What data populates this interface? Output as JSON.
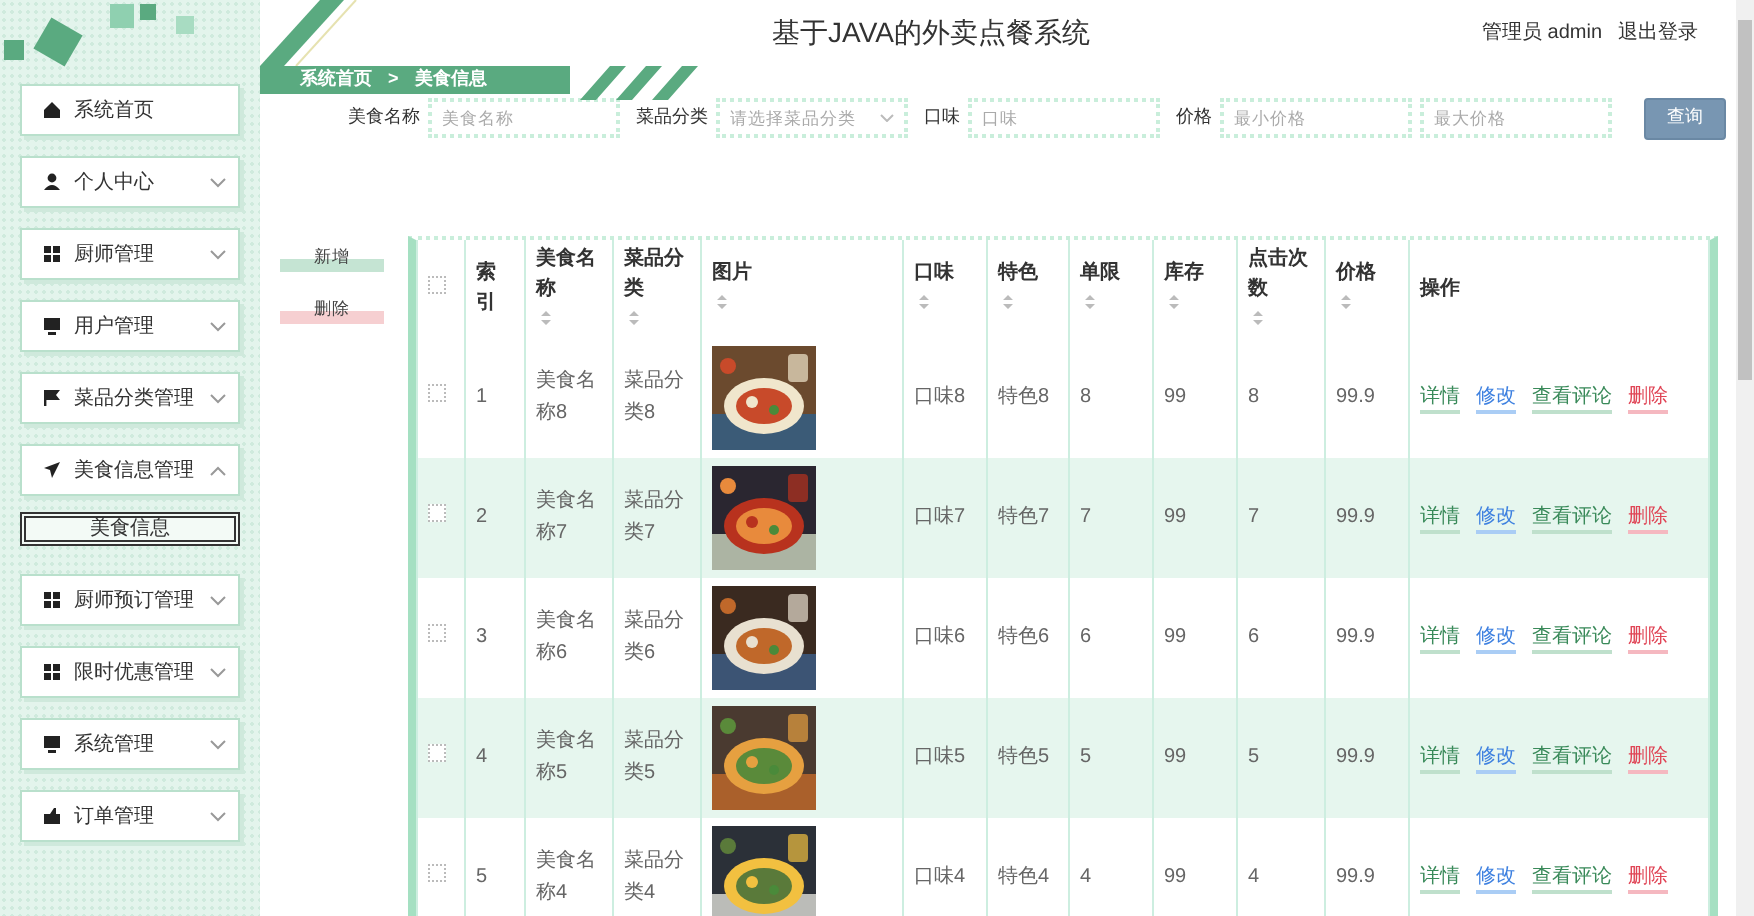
{
  "header": {
    "title": "基于JAVA的外卖点餐系统",
    "user": "管理员 admin",
    "logout": "退出登录"
  },
  "sidebar": {
    "items": [
      {
        "label": "系统首页"
      },
      {
        "label": "个人中心",
        "expanded": false
      },
      {
        "label": "厨师管理",
        "expanded": false
      },
      {
        "label": "用户管理",
        "expanded": false
      },
      {
        "label": "菜品分类管理",
        "expanded": false
      },
      {
        "label": "美食信息管理",
        "expanded": true,
        "children": [
          {
            "label": "美食信息",
            "selected": true
          }
        ]
      },
      {
        "label": "厨师预订管理",
        "expanded": false
      },
      {
        "label": "限时优惠管理",
        "expanded": false
      },
      {
        "label": "系统管理",
        "expanded": false
      },
      {
        "label": "订单管理",
        "expanded": false
      }
    ]
  },
  "breadcrumb": {
    "items": [
      "系统首页",
      "美食信息"
    ],
    "separator": ">"
  },
  "search": {
    "fields": [
      {
        "label": "美食名称",
        "placeholder": "美食名称",
        "kind": "input"
      },
      {
        "label": "菜品分类",
        "placeholder": "请选择菜品分类",
        "kind": "select"
      },
      {
        "label": "口味",
        "placeholder": "口味",
        "kind": "input"
      },
      {
        "label": "价格",
        "placeholder": "最小价格",
        "kind": "input"
      },
      {
        "placeholder": "最大价格",
        "kind": "input"
      }
    ],
    "button": "查询"
  },
  "actions": [
    {
      "label": "新增",
      "kind": "add"
    },
    {
      "label": "删除",
      "kind": "delete"
    }
  ],
  "table": {
    "select_all_checked": false,
    "columns": [
      {
        "label": "索引",
        "sortable": false
      },
      {
        "label": "美食名称",
        "sortable": true
      },
      {
        "label": "菜品分类",
        "sortable": true
      },
      {
        "label": "图片",
        "sortable": true
      },
      {
        "label": "口味",
        "sortable": true
      },
      {
        "label": "特色",
        "sortable": true
      },
      {
        "label": "单限",
        "sortable": true
      },
      {
        "label": "库存",
        "sortable": true
      },
      {
        "label": "点击次数",
        "sortable": true
      },
      {
        "label": "价格",
        "sortable": true
      },
      {
        "label": "操作",
        "sortable": false
      }
    ],
    "rows": [
      {
        "checked": false,
        "cells": [
          "1",
          "美食名称8",
          "菜品分类8",
          {
            "kind": "picture"
          },
          "口味8",
          "特色8",
          "8",
          "99",
          "8",
          "99.9"
        ],
        "actions": [
          {
            "label": "详情",
            "kind": "detail"
          },
          {
            "label": "修改",
            "kind": "edit"
          },
          {
            "label": "查看评论",
            "kind": "comments"
          },
          {
            "label": "删除",
            "kind": "delete"
          }
        ]
      },
      {
        "checked": false,
        "cells": [
          "2",
          "美食名称7",
          "菜品分类7",
          {
            "kind": "picture"
          },
          "口味7",
          "特色7",
          "7",
          "99",
          "7",
          "99.9"
        ],
        "actions": [
          {
            "label": "详情",
            "kind": "detail"
          },
          {
            "label": "修改",
            "kind": "edit"
          },
          {
            "label": "查看评论",
            "kind": "comments"
          },
          {
            "label": "删除",
            "kind": "delete"
          }
        ]
      },
      {
        "checked": false,
        "cells": [
          "3",
          "美食名称6",
          "菜品分类6",
          {
            "kind": "picture"
          },
          "口味6",
          "特色6",
          "6",
          "99",
          "6",
          "99.9"
        ],
        "actions": [
          {
            "label": "详情",
            "kind": "detail"
          },
          {
            "label": "修改",
            "kind": "edit"
          },
          {
            "label": "查看评论",
            "kind": "comments"
          },
          {
            "label": "删除",
            "kind": "delete"
          }
        ]
      },
      {
        "checked": false,
        "cells": [
          "4",
          "美食名称5",
          "菜品分类5",
          {
            "kind": "picture"
          },
          "口味5",
          "特色5",
          "5",
          "99",
          "5",
          "99.9"
        ],
        "actions": [
          {
            "label": "详情",
            "kind": "detail"
          },
          {
            "label": "修改",
            "kind": "edit"
          },
          {
            "label": "查看评论",
            "kind": "comments"
          },
          {
            "label": "删除",
            "kind": "delete"
          }
        ]
      },
      {
        "checked": false,
        "cells": [
          "5",
          "美食名称4",
          "菜品分类4",
          {
            "kind": "picture"
          },
          "口味4",
          "特色4",
          "4",
          "99",
          "4",
          "99.9"
        ],
        "actions": [
          {
            "label": "详情",
            "kind": "detail"
          },
          {
            "label": "修改",
            "kind": "edit"
          },
          {
            "label": "查看评论",
            "kind": "comments"
          },
          {
            "label": "删除",
            "kind": "delete"
          }
        ]
      }
    ]
  }
}
